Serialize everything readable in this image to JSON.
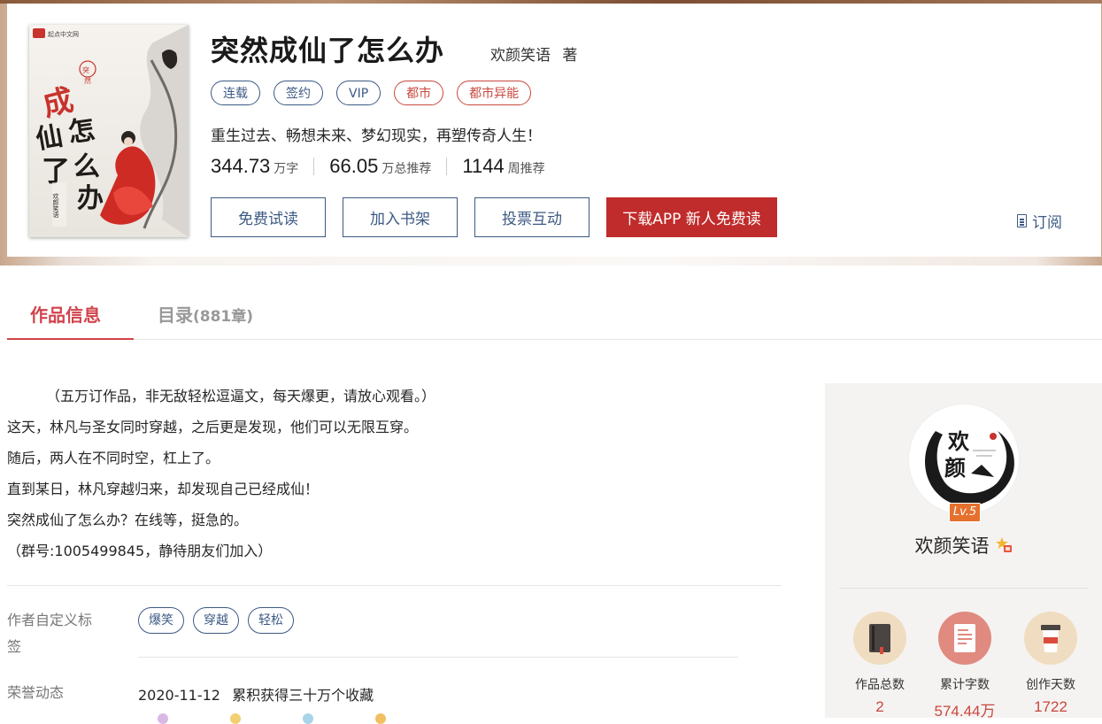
{
  "book": {
    "title": "突然成仙了怎么办",
    "author": "欢颜笑语",
    "author_suffix": "著",
    "tags": [
      {
        "label": "连载",
        "style": "blue"
      },
      {
        "label": "签约",
        "style": "blue"
      },
      {
        "label": "VIP",
        "style": "blue"
      },
      {
        "label": "都市",
        "style": "red"
      },
      {
        "label": "都市异能",
        "style": "red"
      }
    ],
    "intro": "重生过去、畅想未来、梦幻现实，再塑传奇人生！",
    "stats": [
      {
        "value": "344.73",
        "unit": "万字"
      },
      {
        "value": "66.05",
        "unit": "万总推荐"
      },
      {
        "value": "1144",
        "unit": "周推荐"
      }
    ],
    "buttons": {
      "free_read": "免费试读",
      "add_shelf": "加入书架",
      "vote": "投票互动",
      "download": "下载APP  新人免费读"
    },
    "subscribe": "订阅",
    "cover": {
      "publisher": "起点中文网",
      "title_text": "成仙了怎么办",
      "tag_text": "突然",
      "author_text": "欢颜笑语"
    }
  },
  "tabs": {
    "info": "作品信息",
    "catalog": "目录",
    "catalog_count": "(881章)"
  },
  "description": [
    "（五万订作品，非无敌轻松逗逼文，每天爆更，请放心观看。）",
    "这天，林凡与圣女同时穿越，之后更是发现，他们可以无限互穿。",
    "随后，两人在不同时空，杠上了。",
    "直到某日，林凡穿越归来，却发现自己已经成仙！",
    "突然成仙了怎么办？在线等，挺急的。",
    "（群号:1005499845，静待朋友们加入）"
  ],
  "custom_tags": {
    "label": "作者自定义标签",
    "label_line1": "作者自定义标",
    "label_line2": "签",
    "items": [
      "爆笑",
      "穿越",
      "轻松"
    ]
  },
  "honor": {
    "label": "荣誉动态",
    "date": "2020-11-12",
    "text": "累积获得三十万个收藏"
  },
  "author_panel": {
    "name": "欢颜笑语",
    "level": "Lv.5",
    "avatar_text": [
      "欢",
      "颜"
    ],
    "stats": [
      {
        "label": "作品总数",
        "value": "2",
        "icon": "book-icon",
        "color": "#f0dcc0"
      },
      {
        "label": "累计字数",
        "value": "574.44万",
        "icon": "document-icon",
        "color": "#e08a80"
      },
      {
        "label": "创作天数",
        "value": "1722",
        "icon": "coffee-cup-icon",
        "color": "#f0dcc0"
      }
    ]
  },
  "colors": {
    "accent_red": "#c02c2b",
    "tab_red": "#d0434c",
    "link_blue": "#3d5a84"
  }
}
